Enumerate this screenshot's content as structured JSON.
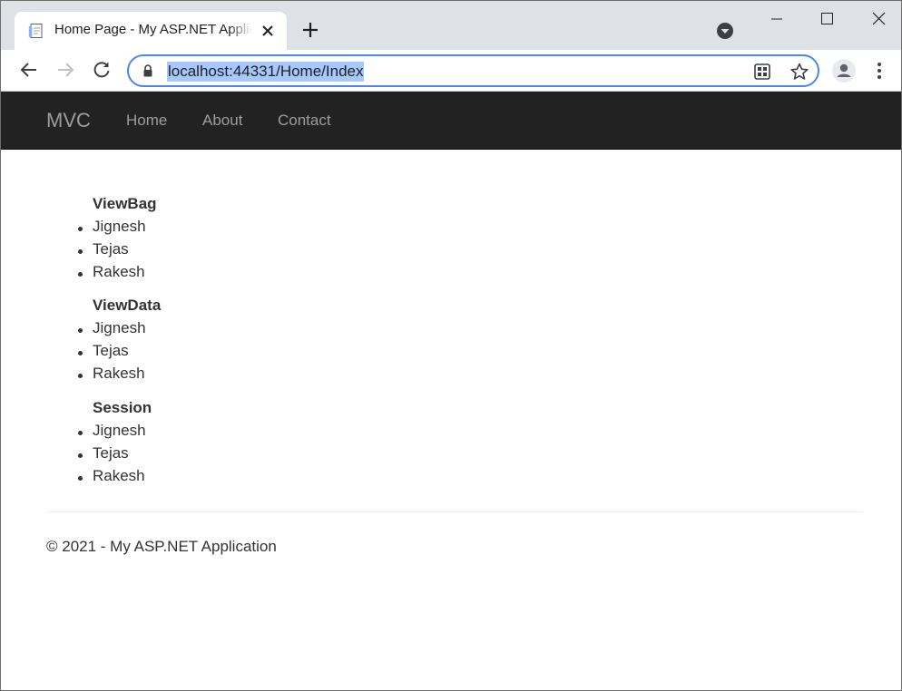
{
  "browser": {
    "tab": {
      "title": "Home Page - My ASP.NET Application",
      "favicon": "page-icon"
    },
    "address_bar": {
      "url": "localhost:44331/Home/Index",
      "secure_icon": "lock-icon"
    },
    "accent_color": "#4d86e8",
    "selection_color": "#a8c7fa"
  },
  "site": {
    "brand": "MVC",
    "nav": [
      {
        "label": "Home"
      },
      {
        "label": "About"
      },
      {
        "label": "Contact"
      }
    ],
    "navbar_color": "#222222"
  },
  "main": {
    "sections": [
      {
        "title": "ViewBag",
        "items": [
          "Jignesh",
          "Tejas",
          "Rakesh"
        ]
      },
      {
        "title": "ViewData",
        "items": [
          "Jignesh",
          "Tejas",
          "Rakesh"
        ]
      },
      {
        "title": "Session",
        "items": [
          "Jignesh",
          "Tejas",
          "Rakesh"
        ]
      }
    ]
  },
  "footer": {
    "text": "© 2021 - My ASP.NET Application"
  }
}
